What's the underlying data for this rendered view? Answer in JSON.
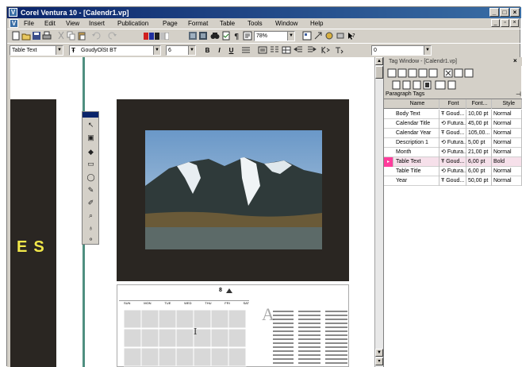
{
  "window": {
    "title": "Corel Ventura 10 - [Calendr1.vp]",
    "app_icon": "V",
    "caption_buttons": [
      "_",
      "□",
      "×"
    ],
    "mdi_buttons": [
      "_",
      "▫",
      "×"
    ]
  },
  "menu": [
    "File",
    "Edit",
    "View",
    "Insert",
    "Publication",
    "Page",
    "Format",
    "Table",
    "Tools",
    "Window",
    "Help"
  ],
  "toolbar1": {
    "zoom": "78%"
  },
  "toolbar2": {
    "tag_combo": "Table Text",
    "font_combo": "GoudyOlSt BT",
    "size_combo": "6",
    "bold": "B",
    "italic": "I",
    "underline": "U",
    "far_combo": "0"
  },
  "document": {
    "left_page_text": "ES",
    "calendar_month_mark": "8",
    "dropcap": "A",
    "weekdays": [
      "SUN",
      "MON",
      "TUE",
      "WED",
      "THU",
      "FRI",
      "SAT"
    ]
  },
  "tag_window": {
    "title": "Tag Window - [Calendr1.vp]",
    "subtitle": "Paragraph Tags",
    "columns": [
      "Name",
      "Font",
      "Font...",
      "Style"
    ],
    "rows": [
      {
        "name": "Body Text",
        "font": "Goud...",
        "size": "10,00 pt",
        "style": "Normal"
      },
      {
        "name": "Calendar Title",
        "font": "Futura...",
        "size": "45,00 pt",
        "style": "Normal"
      },
      {
        "name": "Calendar Year",
        "font": "Goud...",
        "size": "105,00...",
        "style": "Normal"
      },
      {
        "name": "Description 1",
        "font": "Futura...",
        "size": "5,00 pt",
        "style": "Normal"
      },
      {
        "name": "Month",
        "font": "Futura...",
        "size": "21,00 pt",
        "style": "Normal"
      },
      {
        "name": "Table Text",
        "font": "Goud...",
        "size": "6,00 pt",
        "style": "Bold"
      },
      {
        "name": "Table Title",
        "font": "Futura...",
        "size": "6,00 pt",
        "style": "Normal"
      },
      {
        "name": "Year",
        "font": "Goud...",
        "size": "50,00 pt",
        "style": "Normal"
      }
    ],
    "selected_row": 5
  },
  "colors": {
    "title_gradient_start": "#0a246a",
    "title_gradient_end": "#3a6ea5",
    "chrome": "#d4d0c8",
    "dark_page": "#2a2622",
    "accent_yellow": "#f2e84a",
    "rule_green": "#4f8f80",
    "selection_pink": "#ff3c9c"
  }
}
